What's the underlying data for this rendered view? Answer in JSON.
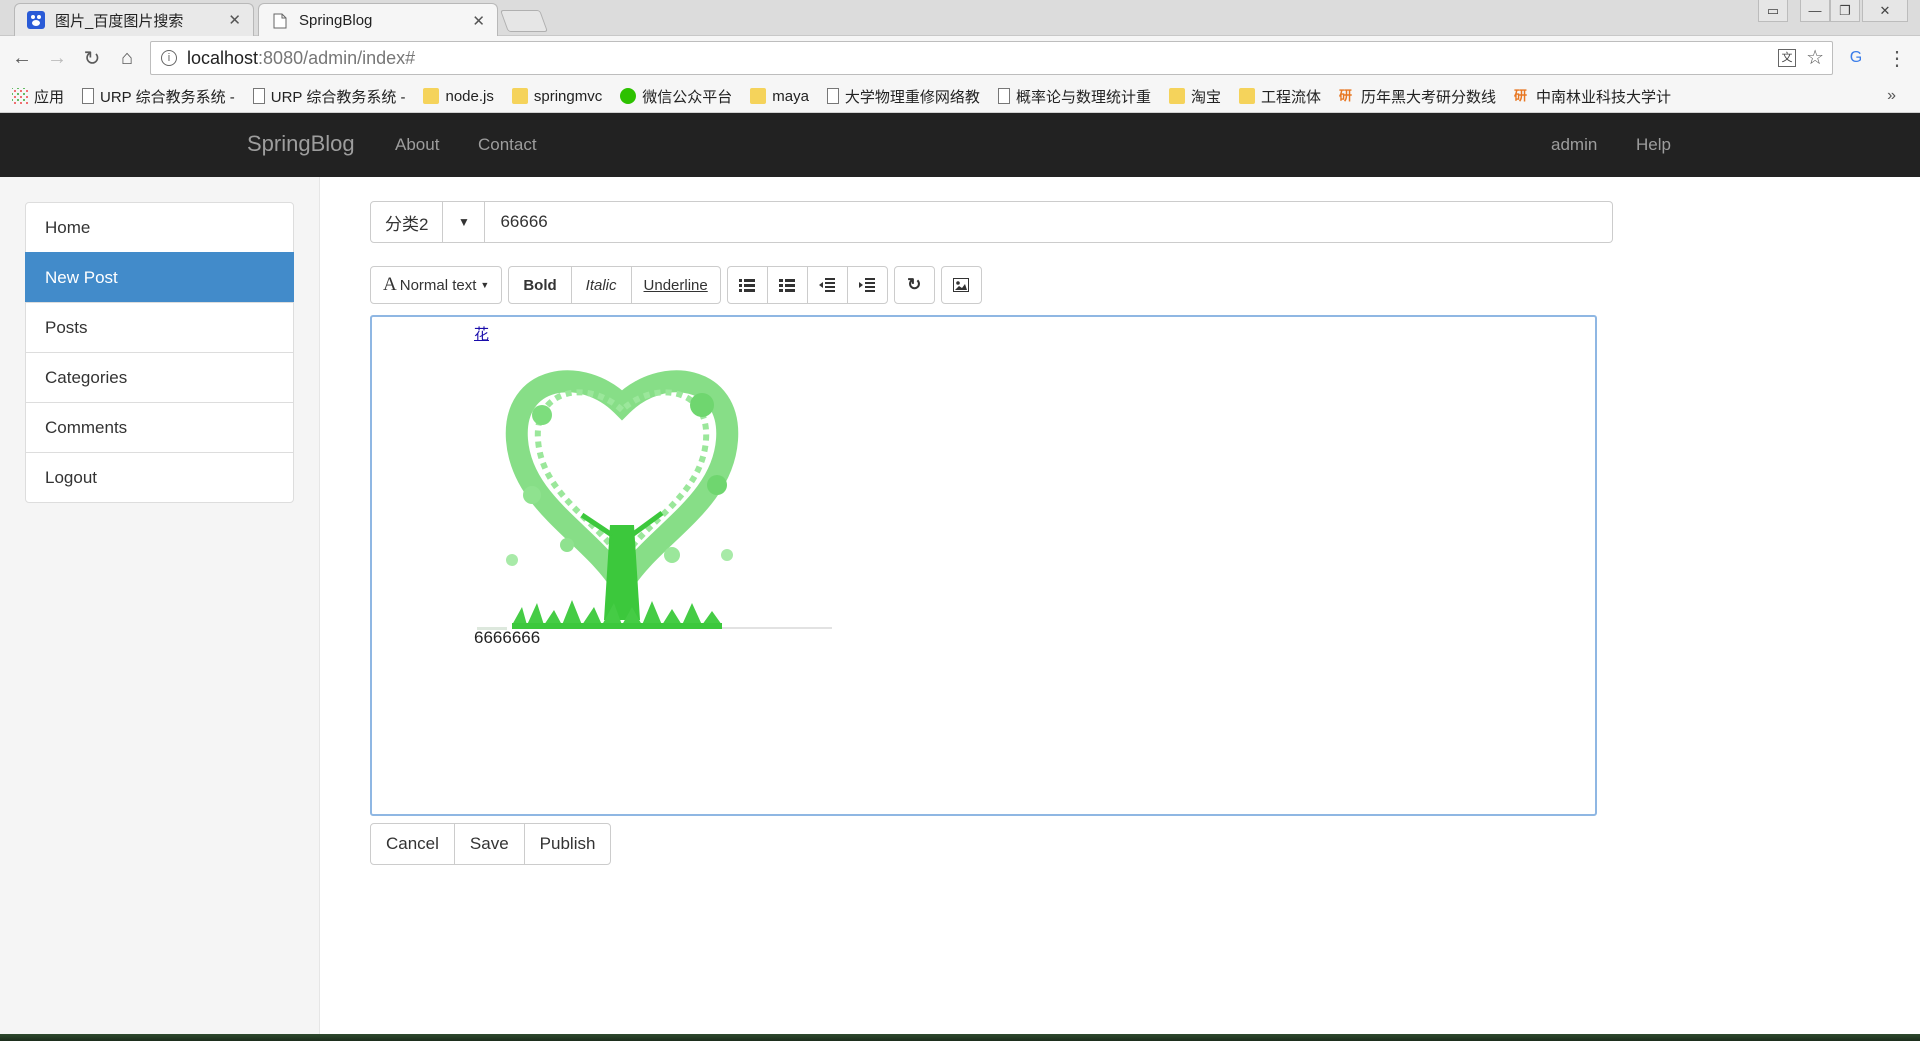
{
  "browser": {
    "tabs": [
      {
        "title": "图片_百度图片搜索",
        "active": false
      },
      {
        "title": "SpringBlog",
        "active": true
      }
    ],
    "url_host": "localhost",
    "url_path": ":8080/admin/index#",
    "bookmarks": [
      {
        "label": "应用",
        "icon": "apps-icon"
      },
      {
        "label": "URP 综合教务系统 - ",
        "icon": "page-icon"
      },
      {
        "label": "URP 综合教务系统 - ",
        "icon": "page-icon"
      },
      {
        "label": "node.js",
        "icon": "folder-icon"
      },
      {
        "label": "springmvc",
        "icon": "folder-icon"
      },
      {
        "label": "微信公众平台",
        "icon": "wechat-icon"
      },
      {
        "label": "maya",
        "icon": "folder-icon"
      },
      {
        "label": "大学物理重修网络教",
        "icon": "page-icon"
      },
      {
        "label": "概率论与数理统计重",
        "icon": "page-icon"
      },
      {
        "label": "淘宝",
        "icon": "folder-icon"
      },
      {
        "label": "工程流体",
        "icon": "folder-icon"
      },
      {
        "label": "历年黑大考研分数线",
        "icon": "yan-icon"
      },
      {
        "label": "中南林业科技大学计",
        "icon": "yan-icon"
      }
    ]
  },
  "navbar": {
    "brand": "SpringBlog",
    "links": [
      "About",
      "Contact"
    ],
    "right_links": [
      "admin",
      "Help"
    ]
  },
  "sidebar": {
    "items": [
      {
        "label": "Home",
        "active": false
      },
      {
        "label": "New Post",
        "active": true
      },
      {
        "label": "Posts",
        "active": false
      },
      {
        "label": "Categories",
        "active": false
      },
      {
        "label": "Comments",
        "active": false
      },
      {
        "label": "Logout",
        "active": false
      }
    ]
  },
  "post": {
    "category": "分类2",
    "title": "66666"
  },
  "editor_toolbar": {
    "format_label": "Normal text",
    "bold": "Bold",
    "italic": "Italic",
    "underline": "Underline"
  },
  "editor": {
    "link_text": "花",
    "body_text": "6666666",
    "image_subject": "green floral tree"
  },
  "actions": {
    "cancel": "Cancel",
    "save": "Save",
    "publish": "Publish"
  },
  "colors": {
    "navbar_bg": "#222222",
    "active_item": "#428bca",
    "editor_focus_border": "#8fb7e3",
    "tree_green": "#3cc83c"
  }
}
